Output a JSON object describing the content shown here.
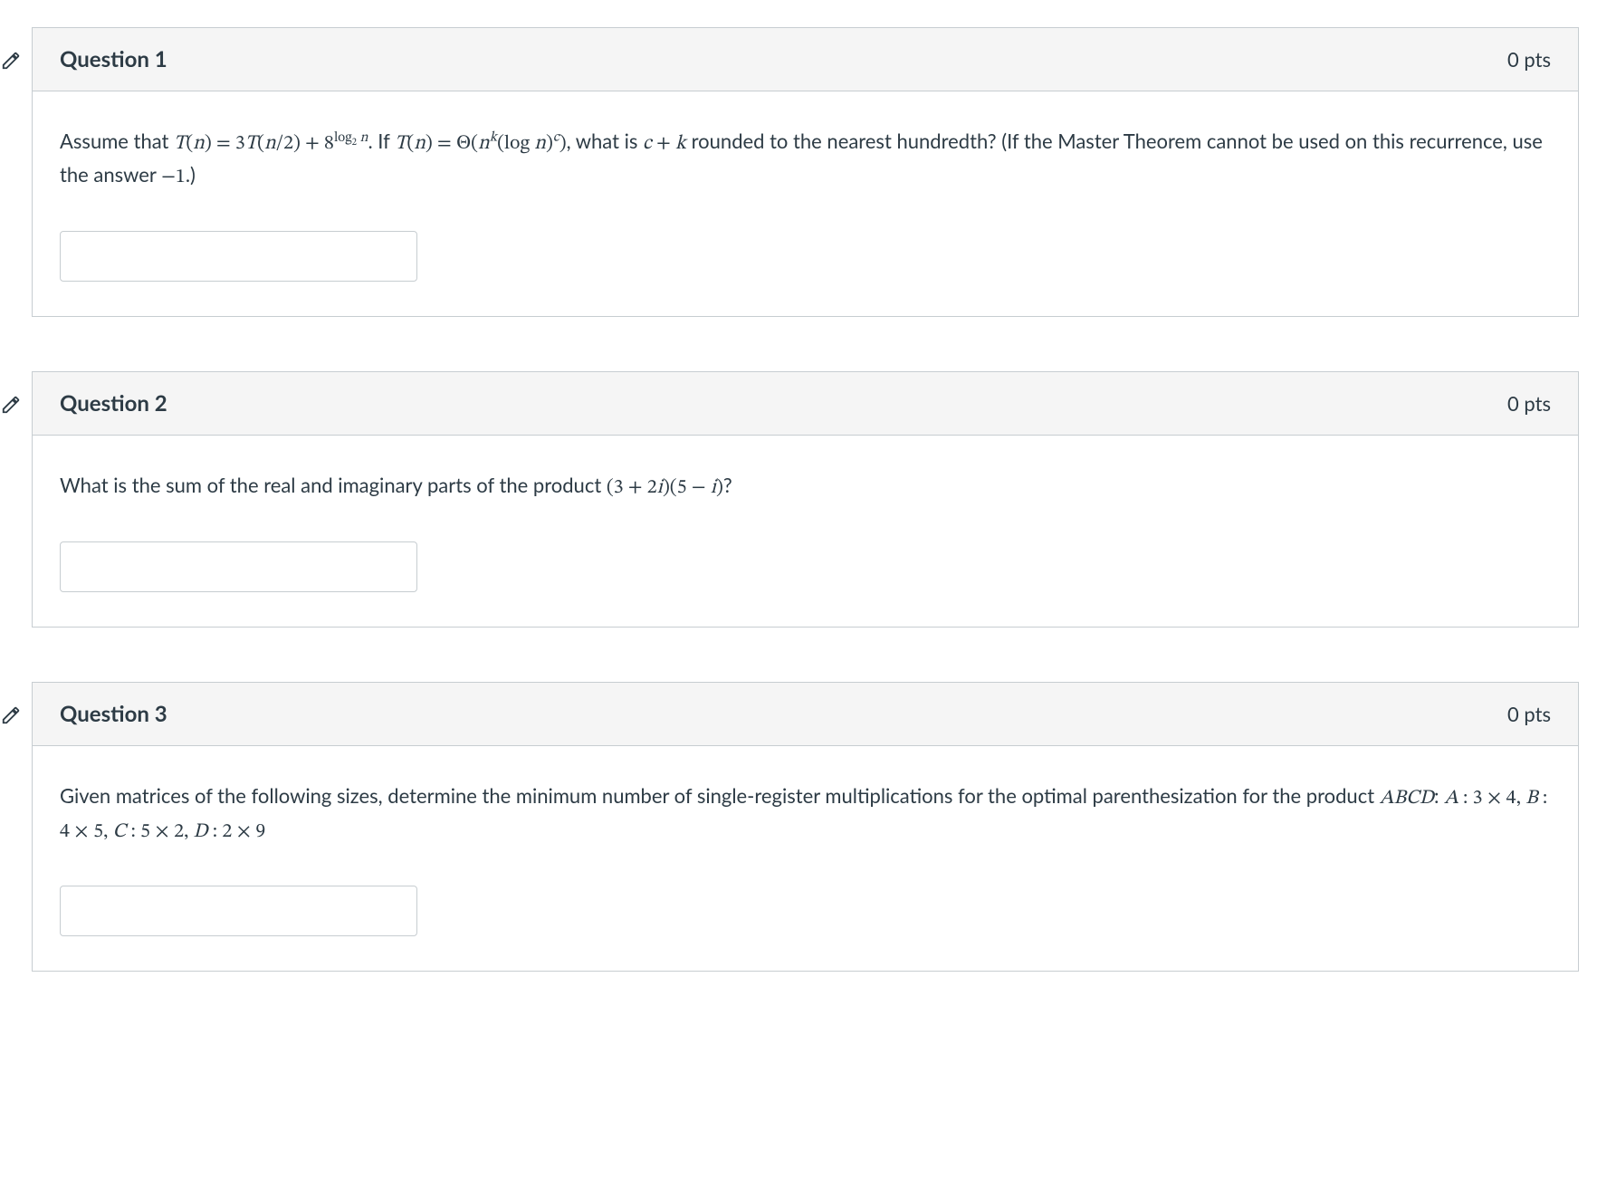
{
  "questions": [
    {
      "label": "Question 1",
      "pts": "0 pts",
      "prompt_pre": "Assume that ",
      "expr1_a": "T",
      "expr1_b": "(",
      "expr1_c": "n",
      "expr1_d": ") = 3",
      "expr1_e": "T",
      "expr1_f": "(",
      "expr1_g": "n",
      "expr1_h": "/2) + 8",
      "expr1_sup1": "log",
      "expr1_sup_sub": "2",
      "expr1_sup2": " n",
      "prompt_mid1": ". If ",
      "expr2_a": "T",
      "expr2_b": "(",
      "expr2_c": "n",
      "expr2_d": ") = Θ(",
      "expr2_e": "n",
      "expr2_sup_k": "k",
      "expr2_f": "(log ",
      "expr2_g": "n",
      "expr2_h": ")",
      "expr2_sup_c": "c",
      "expr2_i": ")",
      "prompt_mid2": ", what is ",
      "expr3_a": "c",
      "expr3_b": " + ",
      "expr3_c": "k",
      "prompt_mid3": " rounded to the nearest hundredth? (If the Master Theorem cannot be used on this recurrence, use the answer ",
      "expr4": "−1",
      "prompt_end": ".)"
    },
    {
      "label": "Question 2",
      "pts": "0 pts",
      "prompt_pre": "What is the sum of the real and imaginary parts of the product ",
      "expr_a": "(3 + 2",
      "expr_b": "i",
      "expr_c": ")(5 − ",
      "expr_d": "i",
      "expr_e": ")",
      "prompt_end": "?"
    },
    {
      "label": "Question 3",
      "pts": "0 pts",
      "prompt_pre": "Given matrices of the following sizes, determine the minimum number of single-register multiplications for the optimal parenthesization for the product ",
      "expr_abcd": "ABCD",
      "prompt_mid": ": ",
      "expr_a1": "A",
      "expr_a2": " : 3 × 4, ",
      "expr_b1": "B",
      "expr_b2": " : 4 × 5, ",
      "expr_c1": "C",
      "expr_c2": " : 5 × 2, ",
      "expr_d1": "D",
      "expr_d2": " : 2 × 9"
    }
  ]
}
